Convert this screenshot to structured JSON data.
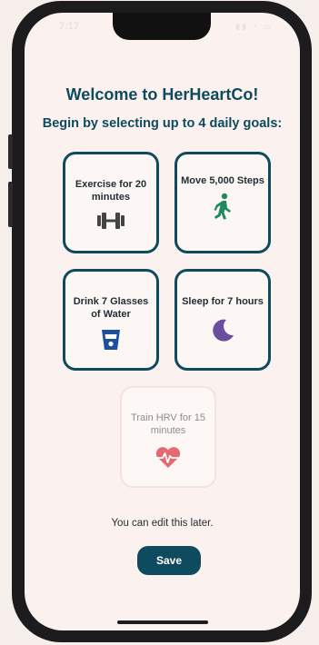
{
  "status": {
    "time": "7:17",
    "icons": "▮▮ ◔ ▭"
  },
  "header": {
    "title": "Welcome to HerHeartCo!",
    "subtitle": "Begin by selecting up to 4 daily goals:"
  },
  "goals": [
    {
      "label": "Exercise for 20 minutes",
      "icon": "dumbbell-icon",
      "selected": true,
      "color": "#444444"
    },
    {
      "label": "Move 5,000 Steps",
      "icon": "walking-person-icon",
      "selected": true,
      "color": "#1e8a5e"
    },
    {
      "label": "Drink 7 Glasses of Water",
      "icon": "water-glass-icon",
      "selected": true,
      "color": "#1b4fa0"
    },
    {
      "label": "Sleep for 7 hours",
      "icon": "moon-icon",
      "selected": true,
      "color": "#6b4f9e"
    },
    {
      "label": "Train HRV for 15 minutes",
      "icon": "heartbeat-icon",
      "selected": false,
      "color": "#e36a6e"
    }
  ],
  "footer": {
    "hint": "You can edit this later.",
    "save_label": "Save"
  },
  "colors": {
    "accent": "#0f4b5e",
    "background": "#fbf1ee"
  }
}
